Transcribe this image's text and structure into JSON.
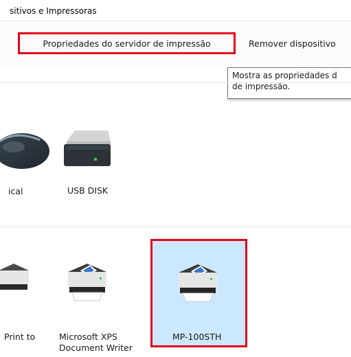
{
  "breadcrumb": {
    "text": "sitivos e Impressoras"
  },
  "toolbar": {
    "server_properties_label": "Propriedades do servidor de impressão",
    "remove_device_label": "Remover dispositivo"
  },
  "tooltip": {
    "line1": "Mostra as propriedades d",
    "line2": "de impressão."
  },
  "devices": [
    {
      "label": "ical",
      "icon": "mouse-icon"
    },
    {
      "label": "USB DISK",
      "icon": "drive-icon"
    }
  ],
  "printers": [
    {
      "label": "Print to",
      "icon": "printer-icon"
    },
    {
      "label_line1": "Microsoft XPS",
      "label_line2": "Document Writer",
      "icon": "printer-icon"
    },
    {
      "label": "MP-100STH",
      "icon": "printer-icon",
      "selected": true
    }
  ],
  "colors": {
    "highlight_border": "#e3001b",
    "selection_bg": "#cce8ff"
  }
}
